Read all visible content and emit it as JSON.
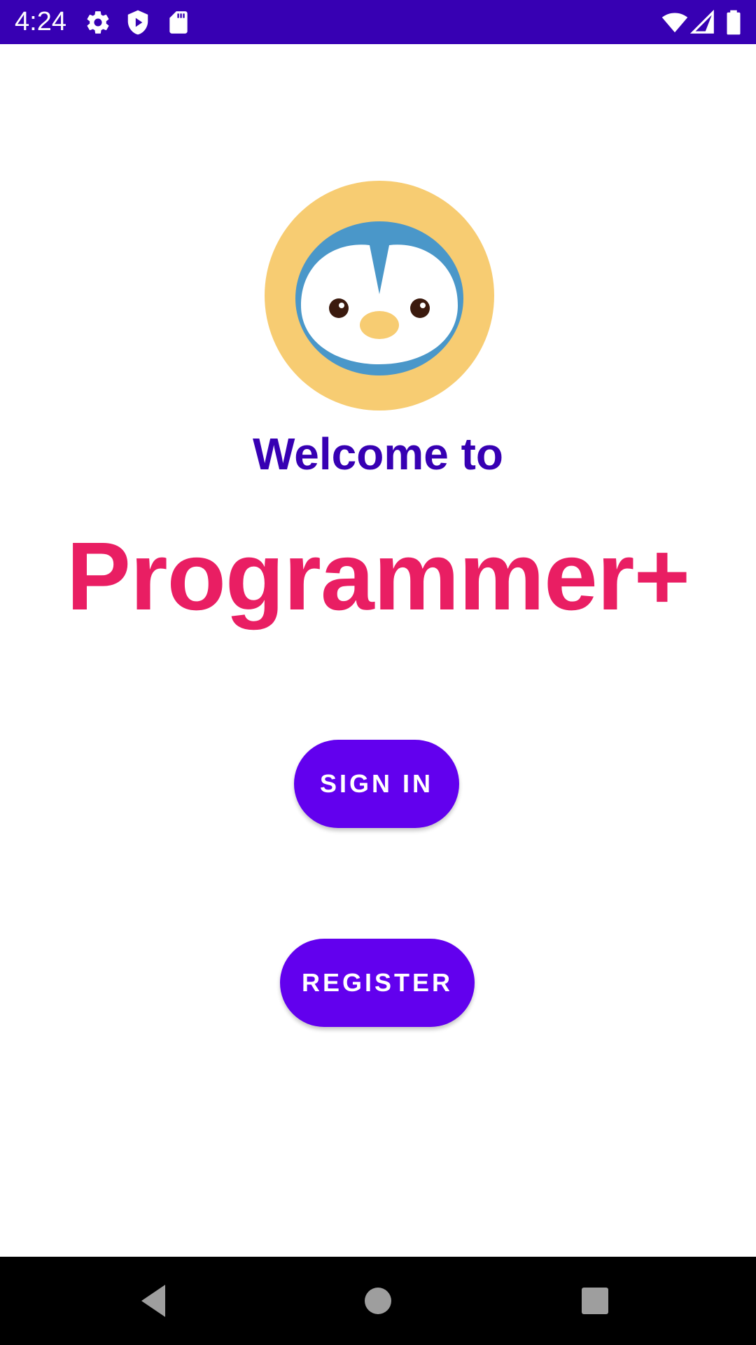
{
  "status_bar": {
    "time": "4:24",
    "background": "#3700B3",
    "icons": [
      "settings-icon",
      "play-protect-icon",
      "sd-card-icon",
      "wifi-icon",
      "cell-signal-icon",
      "battery-icon"
    ]
  },
  "logo": {
    "icon": "penguin-logo",
    "ring_color": "#F7CC72",
    "head_color": "#4A97C9"
  },
  "welcome_text": "Welcome to",
  "app_name": "Programmer+",
  "colors": {
    "primary": "#6200EE",
    "primary_dark": "#3700B3",
    "accent": "#E91E63"
  },
  "buttons": {
    "sign_in": "SIGN IN",
    "register": "REGISTER"
  },
  "nav_bar": {
    "icons": [
      "back-icon",
      "home-icon",
      "recents-icon"
    ]
  }
}
